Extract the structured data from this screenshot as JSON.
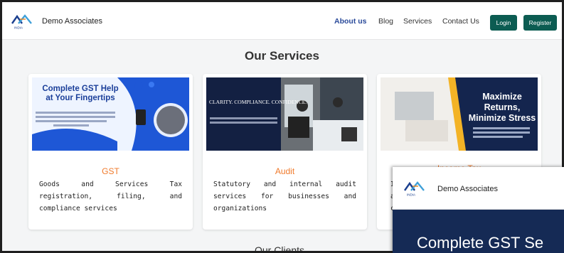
{
  "brand": {
    "name": "Demo Associates",
    "logo_sub": "INDIA"
  },
  "nav": {
    "about": "About us",
    "blog": "Blog",
    "services": "Services",
    "contact": "Contact Us",
    "login": "Login",
    "register": "Register"
  },
  "services_section": {
    "title": "Our Services",
    "cards": [
      {
        "title": "GST",
        "description": "Goods and Services Tax registration, filing, and compliance services",
        "banner_heading": "Complete GST Help at Your Fingertips"
      },
      {
        "title": "Audit",
        "description": "Statutory and internal audit services for businesses and organizations",
        "banner_heading": "CLARITY. COMPLIANCE. CONFIDENCE."
      },
      {
        "title": "Income Tax",
        "banner_heading": "Maximize Returns, Minimize Stress",
        "desc_peek": [
          "Ir",
          "ac",
          "c"
        ]
      }
    ]
  },
  "clients_section": {
    "title": "Our Clients"
  },
  "overlay": {
    "brand": "Demo Associates",
    "hero_text": "Complete GST Se"
  },
  "colors": {
    "accent_orange": "#f07a2b",
    "nav_active": "#2a4a9a",
    "button_green": "#0c5c52",
    "hero_navy": "#152a55"
  }
}
